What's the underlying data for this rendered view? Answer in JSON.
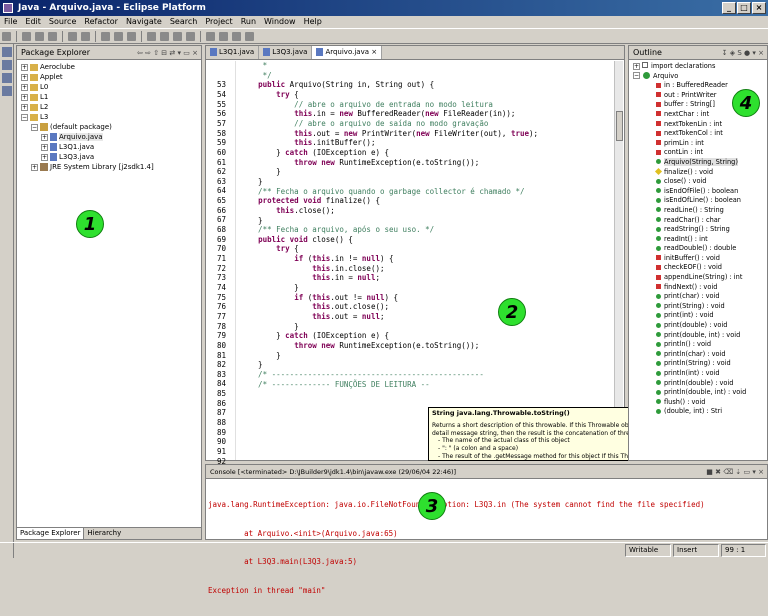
{
  "window": {
    "title": "Java - Arquivo.java - Eclipse Platform",
    "min": "_",
    "max": "□",
    "close": "×"
  },
  "menu": [
    "File",
    "Edit",
    "Source",
    "Refactor",
    "Navigate",
    "Search",
    "Project",
    "Run",
    "Window",
    "Help"
  ],
  "package_explorer": {
    "title": "Package Explorer",
    "items": [
      "Aeroclube",
      "Applet",
      "L0",
      "L1",
      "L2",
      "L3",
      "(default package)",
      "Arquivo.java",
      "L3Q1.java",
      "L3Q3.java",
      "JRE System Library [j2sdk1.4]"
    ],
    "tabs": [
      "Package Explorer",
      "Hierarchy"
    ]
  },
  "editor": {
    "tabs": [
      "L3Q1.java",
      "L3Q3.java",
      "Arquivo.java"
    ],
    "line_numbers": [
      "",
      "",
      "53",
      "54",
      "55",
      "56",
      "57",
      "58",
      "59",
      "60",
      "61",
      "62",
      "63",
      "64",
      "65",
      "66",
      "67",
      "68",
      "69",
      "70",
      "71",
      "72",
      "73",
      "74",
      "75",
      "76",
      "77",
      "78",
      "79",
      "80",
      "81",
      "82",
      "83",
      "84",
      "85",
      "86",
      "87",
      "88",
      "89",
      "90",
      "91",
      "92"
    ],
    "lines": [
      "     *",
      "     */",
      "    public Arquivo(String in, String out) {",
      "        try {",
      "            // abre o arquivo de entrada no modo leitura",
      "            this.in = new BufferedReader(new FileReader(in));",
      "",
      "            // abre o arquivo de saída no modo gravação",
      "            this.out = new PrintWriter(new FileWriter(out), true);",
      "",
      "            this.initBuffer();",
      "",
      "        } catch (IOException e) {",
      "            throw new RuntimeException(e.toString());",
      "        }",
      "    }",
      "",
      "    /** Fecha o arquivo quando o garbage collector é chamado */",
      "    protected void finalize() {",
      "        this.close();",
      "    }",
      "",
      "    /** Fecha o arquivo, após o seu uso. */",
      "    public void close() {",
      "        try {",
      "            if (this.in != null) {",
      "                this.in.close();",
      "                this.in = null;",
      "            }",
      "",
      "            if (this.out != null) {",
      "                this.out.close();",
      "                this.out = null;",
      "            }",
      "        } catch (IOException e) {",
      "            throw new RuntimeException(e.toString());",
      "        }",
      "    }",
      "",
      "    /* -----------------------------------------------",
      "    /* ------------- FUNÇÕES DE LEITURA --",
      ""
    ],
    "tooltip": {
      "title": "String java.lang.Throwable.toString()",
      "lines": [
        "Returns a short description of this throwable. If this Throwable object was created with a non-null",
        "detail message string, then the result is the concatenation of three strings:",
        "  - The name of the actual class of this object",
        "  - \": \" (a colon and a space)",
        "  - The result of the .getMessage method for this object If this Throwable object was"
      ]
    }
  },
  "outline": {
    "title": "Outline",
    "import": "import declarations",
    "class": "Arquivo",
    "members": [
      {
        "label": "in : BufferedReader",
        "kind": "field"
      },
      {
        "label": "out : PrintWriter",
        "kind": "field"
      },
      {
        "label": "buffer : String[]",
        "kind": "field"
      },
      {
        "label": "nextChar : int",
        "kind": "field"
      },
      {
        "label": "nextTokenLin : int",
        "kind": "field"
      },
      {
        "label": "nextTokenCol : int",
        "kind": "field"
      },
      {
        "label": "primLin : int",
        "kind": "field"
      },
      {
        "label": "contLin : int",
        "kind": "field"
      },
      {
        "label": "Arquivo(String, String)",
        "kind": "ctor"
      },
      {
        "label": "finalize() : void",
        "kind": "prot"
      },
      {
        "label": "close() : void",
        "kind": "method"
      },
      {
        "label": "isEndOfFile() : boolean",
        "kind": "method"
      },
      {
        "label": "isEndOfLine() : boolean",
        "kind": "method"
      },
      {
        "label": "readLine() : String",
        "kind": "method"
      },
      {
        "label": "readChar() : char",
        "kind": "method"
      },
      {
        "label": "readString() : String",
        "kind": "method"
      },
      {
        "label": "readInt() : int",
        "kind": "method"
      },
      {
        "label": "readDouble() : double",
        "kind": "method"
      },
      {
        "label": "initBuffer() : void",
        "kind": "private"
      },
      {
        "label": "checkEOF() : void",
        "kind": "private"
      },
      {
        "label": "appendLine(String) : int",
        "kind": "private"
      },
      {
        "label": "findNext() : void",
        "kind": "private"
      },
      {
        "label": "print(char) : void",
        "kind": "method"
      },
      {
        "label": "print(String) : void",
        "kind": "method"
      },
      {
        "label": "print(int) : void",
        "kind": "method"
      },
      {
        "label": "print(double) : void",
        "kind": "method"
      },
      {
        "label": "print(double, int) : void",
        "kind": "method"
      },
      {
        "label": "println() : void",
        "kind": "method"
      },
      {
        "label": "println(char) : void",
        "kind": "method"
      },
      {
        "label": "println(String) : void",
        "kind": "method"
      },
      {
        "label": "println(int) : void",
        "kind": "method"
      },
      {
        "label": "println(double) : void",
        "kind": "method"
      },
      {
        "label": "println(double, int) : void",
        "kind": "method"
      },
      {
        "label": "flush() : void",
        "kind": "method"
      },
      {
        "label": "(double, int) : Stri",
        "kind": "method"
      }
    ]
  },
  "console": {
    "title": "Console [<terminated> D:\\JBuilder9\\jdk1.4\\bin\\javaw.exe (29/06/04 22:46)]",
    "lines": [
      "java.lang.RuntimeException: java.io.FileNotFoundException: L3Q3.in (The system cannot find the file specified)",
      "\tat Arquivo.<init>(Arquivo.java:65)",
      "\tat L3Q3.main(L3Q3.java:5)",
      "Exception in thread \"main\""
    ]
  },
  "status": {
    "mode1": "Writable",
    "mode2": "Insert",
    "position": "99 : 1"
  },
  "callouts": [
    "1",
    "2",
    "3",
    "4"
  ],
  "colors": {
    "keyword": "#7f0055",
    "comment": "#3f7f5f",
    "string": "#2a00ff",
    "callout": "#2ee02e",
    "error": "#c00000"
  }
}
